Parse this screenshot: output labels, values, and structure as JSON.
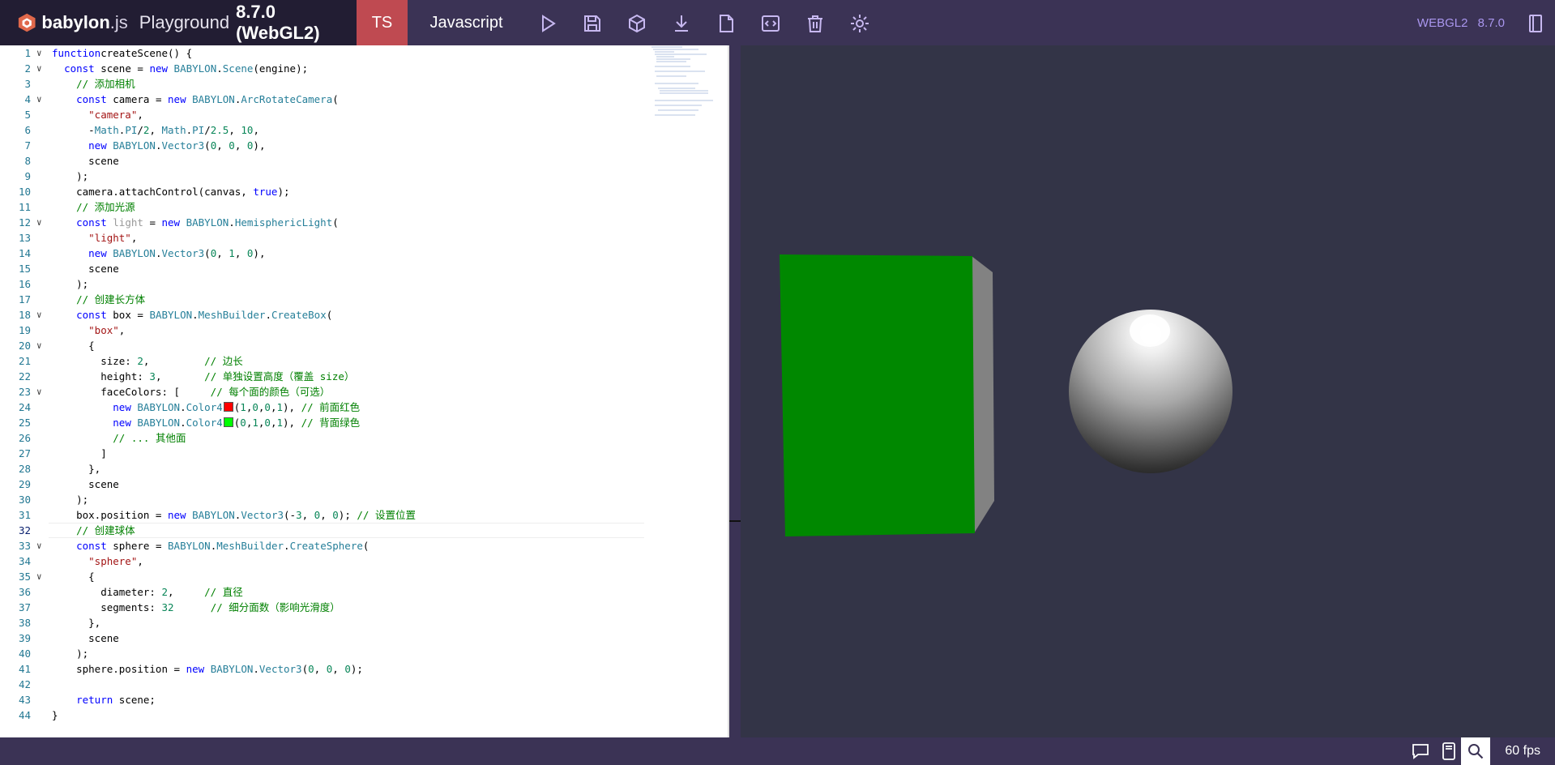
{
  "header": {
    "brand_name": "babylon",
    "brand_suffix": ".js",
    "playground_label": "Playground",
    "version_label": "8.7.0 (WebGL2)",
    "tab_ts": "TS",
    "tab_js": "Javascript",
    "renderer": "WEBGL2",
    "renderer_version": "8.7.0"
  },
  "toolbar": [
    "run-icon",
    "save-icon",
    "download-snippet-icon",
    "download-icon",
    "new-file-icon",
    "format-icon",
    "clear-icon",
    "settings-icon"
  ],
  "editor": {
    "active_line": 32,
    "lines": [
      {
        "n": "1",
        "fold": true,
        "tokens": [
          [
            "kw",
            "function"
          ],
          [
            "",
            "createScene() {"
          ]
        ]
      },
      {
        "n": "2",
        "fold": true,
        "tokens": [
          [
            "",
            "  "
          ],
          [
            "kw",
            "const"
          ],
          [
            "",
            " scene = "
          ],
          [
            "kw",
            "new"
          ],
          [
            "",
            " "
          ],
          [
            "ty",
            "BABYLON"
          ],
          [
            "",
            "."
          ],
          [
            "ty",
            "Scene"
          ],
          [
            "",
            "(engine);"
          ]
        ]
      },
      {
        "n": "3",
        "fold": false,
        "tokens": [
          [
            "",
            "    "
          ],
          [
            "cm",
            "// 添加相机"
          ]
        ]
      },
      {
        "n": "4",
        "fold": true,
        "tokens": [
          [
            "",
            "    "
          ],
          [
            "kw",
            "const"
          ],
          [
            "",
            " camera = "
          ],
          [
            "kw",
            "new"
          ],
          [
            "",
            " "
          ],
          [
            "ty",
            "BABYLON"
          ],
          [
            "",
            "."
          ],
          [
            "ty",
            "ArcRotateCamera"
          ],
          [
            "",
            "("
          ]
        ]
      },
      {
        "n": "5",
        "fold": false,
        "tokens": [
          [
            "",
            "      "
          ],
          [
            "str",
            "\"camera\""
          ],
          [
            "",
            ","
          ]
        ]
      },
      {
        "n": "6",
        "fold": false,
        "tokens": [
          [
            "",
            "      -"
          ],
          [
            "ty",
            "Math"
          ],
          [
            "",
            "."
          ],
          [
            "ty",
            "PI"
          ],
          [
            "",
            "/"
          ],
          [
            "num",
            "2"
          ],
          [
            "",
            ", "
          ],
          [
            "ty",
            "Math"
          ],
          [
            "",
            "."
          ],
          [
            "ty",
            "PI"
          ],
          [
            "",
            "/"
          ],
          [
            "num",
            "2.5"
          ],
          [
            "",
            ", "
          ],
          [
            "num",
            "10"
          ],
          [
            "",
            ","
          ]
        ]
      },
      {
        "n": "7",
        "fold": false,
        "tokens": [
          [
            "",
            "      "
          ],
          [
            "kw",
            "new"
          ],
          [
            "",
            " "
          ],
          [
            "ty",
            "BABYLON"
          ],
          [
            "",
            "."
          ],
          [
            "ty",
            "Vector3"
          ],
          [
            "",
            "("
          ],
          [
            "num",
            "0"
          ],
          [
            "",
            ", "
          ],
          [
            "num",
            "0"
          ],
          [
            "",
            ", "
          ],
          [
            "num",
            "0"
          ],
          [
            "",
            "),"
          ]
        ]
      },
      {
        "n": "8",
        "fold": false,
        "tokens": [
          [
            "",
            "      scene"
          ]
        ]
      },
      {
        "n": "9",
        "fold": false,
        "tokens": [
          [
            "",
            "    );"
          ]
        ]
      },
      {
        "n": "10",
        "fold": false,
        "tokens": [
          [
            "",
            "    camera.attachControl(canvas, "
          ],
          [
            "kw",
            "true"
          ],
          [
            "",
            ");"
          ]
        ]
      },
      {
        "n": "11",
        "fold": false,
        "tokens": [
          [
            "",
            "    "
          ],
          [
            "cm",
            "// 添加光源"
          ]
        ]
      },
      {
        "n": "12",
        "fold": true,
        "tokens": [
          [
            "",
            "    "
          ],
          [
            "kw",
            "const"
          ],
          [
            "",
            " "
          ],
          [
            "lt",
            "light"
          ],
          [
            "",
            " = "
          ],
          [
            "kw",
            "new"
          ],
          [
            "",
            " "
          ],
          [
            "ty",
            "BABYLON"
          ],
          [
            "",
            "."
          ],
          [
            "ty",
            "HemisphericLight"
          ],
          [
            "",
            "("
          ]
        ]
      },
      {
        "n": "13",
        "fold": false,
        "tokens": [
          [
            "",
            "      "
          ],
          [
            "str",
            "\"light\""
          ],
          [
            "",
            ","
          ]
        ]
      },
      {
        "n": "14",
        "fold": false,
        "tokens": [
          [
            "",
            "      "
          ],
          [
            "kw",
            "new"
          ],
          [
            "",
            " "
          ],
          [
            "ty",
            "BABYLON"
          ],
          [
            "",
            "."
          ],
          [
            "ty",
            "Vector3"
          ],
          [
            "",
            "("
          ],
          [
            "num",
            "0"
          ],
          [
            "",
            ", "
          ],
          [
            "num",
            "1"
          ],
          [
            "",
            ", "
          ],
          [
            "num",
            "0"
          ],
          [
            "",
            "),"
          ]
        ]
      },
      {
        "n": "15",
        "fold": false,
        "tokens": [
          [
            "",
            "      scene"
          ]
        ]
      },
      {
        "n": "16",
        "fold": false,
        "tokens": [
          [
            "",
            "    );"
          ]
        ]
      },
      {
        "n": "17",
        "fold": false,
        "tokens": [
          [
            "",
            "    "
          ],
          [
            "cm",
            "// 创建长方体"
          ]
        ]
      },
      {
        "n": "18",
        "fold": true,
        "tokens": [
          [
            "",
            "    "
          ],
          [
            "kw",
            "const"
          ],
          [
            "",
            " box = "
          ],
          [
            "ty",
            "BABYLON"
          ],
          [
            "",
            "."
          ],
          [
            "ty",
            "MeshBuilder"
          ],
          [
            "",
            "."
          ],
          [
            "ty",
            "CreateBox"
          ],
          [
            "",
            "("
          ]
        ]
      },
      {
        "n": "19",
        "fold": false,
        "tokens": [
          [
            "",
            "      "
          ],
          [
            "str",
            "\"box\""
          ],
          [
            "",
            ","
          ]
        ]
      },
      {
        "n": "20",
        "fold": true,
        "tokens": [
          [
            "",
            "      {"
          ]
        ]
      },
      {
        "n": "21",
        "fold": false,
        "tokens": [
          [
            "",
            "        size: "
          ],
          [
            "num",
            "2"
          ],
          [
            "",
            ",         "
          ],
          [
            "cm",
            "// 边长"
          ]
        ]
      },
      {
        "n": "22",
        "fold": false,
        "tokens": [
          [
            "",
            "        height: "
          ],
          [
            "num",
            "3"
          ],
          [
            "",
            ",       "
          ],
          [
            "cm",
            "// 单独设置高度（覆盖 size）"
          ]
        ]
      },
      {
        "n": "23",
        "fold": true,
        "tokens": [
          [
            "",
            "        faceColors: [     "
          ],
          [
            "cm",
            "// 每个面的颜色（可选）"
          ]
        ]
      },
      {
        "n": "24",
        "fold": false,
        "tokens": [
          [
            "",
            "          "
          ],
          [
            "kw",
            "new"
          ],
          [
            "",
            " "
          ],
          [
            "ty",
            "BABYLON"
          ],
          [
            "",
            "."
          ],
          [
            "ty",
            "Color4"
          ],
          [
            "sw-red",
            ""
          ],
          [
            "",
            "("
          ],
          [
            "num",
            "1"
          ],
          [
            "",
            ","
          ],
          [
            "num",
            "0"
          ],
          [
            "",
            ","
          ],
          [
            "num",
            "0"
          ],
          [
            "",
            ","
          ],
          [
            "num",
            "1"
          ],
          [
            "",
            "), "
          ],
          [
            "cm",
            "// 前面红色"
          ]
        ]
      },
      {
        "n": "25",
        "fold": false,
        "tokens": [
          [
            "",
            "          "
          ],
          [
            "kw",
            "new"
          ],
          [
            "",
            " "
          ],
          [
            "ty",
            "BABYLON"
          ],
          [
            "",
            "."
          ],
          [
            "ty",
            "Color4"
          ],
          [
            "sw-green",
            ""
          ],
          [
            "",
            "("
          ],
          [
            "num",
            "0"
          ],
          [
            "",
            ","
          ],
          [
            "num",
            "1"
          ],
          [
            "",
            ","
          ],
          [
            "num",
            "0"
          ],
          [
            "",
            ","
          ],
          [
            "num",
            "1"
          ],
          [
            "",
            "), "
          ],
          [
            "cm",
            "// 背面绿色"
          ]
        ]
      },
      {
        "n": "26",
        "fold": false,
        "tokens": [
          [
            "",
            "          "
          ],
          [
            "cm",
            "// ... 其他面"
          ]
        ]
      },
      {
        "n": "27",
        "fold": false,
        "tokens": [
          [
            "",
            "        ]"
          ]
        ]
      },
      {
        "n": "28",
        "fold": false,
        "tokens": [
          [
            "",
            "      },"
          ]
        ]
      },
      {
        "n": "29",
        "fold": false,
        "tokens": [
          [
            "",
            "      scene"
          ]
        ]
      },
      {
        "n": "30",
        "fold": false,
        "tokens": [
          [
            "",
            "    );"
          ]
        ]
      },
      {
        "n": "31",
        "fold": false,
        "tokens": [
          [
            "",
            "    box.position = "
          ],
          [
            "kw",
            "new"
          ],
          [
            "",
            " "
          ],
          [
            "ty",
            "BABYLON"
          ],
          [
            "",
            "."
          ],
          [
            "ty",
            "Vector3"
          ],
          [
            "",
            "(-"
          ],
          [
            "num",
            "3"
          ],
          [
            "",
            ", "
          ],
          [
            "num",
            "0"
          ],
          [
            "",
            ", "
          ],
          [
            "num",
            "0"
          ],
          [
            "",
            "); "
          ],
          [
            "cm",
            "// 设置位置"
          ]
        ]
      },
      {
        "n": "32",
        "fold": false,
        "tokens": [
          [
            "",
            "    "
          ],
          [
            "cm",
            "// 创建球体"
          ]
        ]
      },
      {
        "n": "33",
        "fold": true,
        "tokens": [
          [
            "",
            "    "
          ],
          [
            "kw",
            "const"
          ],
          [
            "",
            " sphere = "
          ],
          [
            "ty",
            "BABYLON"
          ],
          [
            "",
            "."
          ],
          [
            "ty",
            "MeshBuilder"
          ],
          [
            "",
            "."
          ],
          [
            "ty",
            "CreateSphere"
          ],
          [
            "",
            "("
          ]
        ]
      },
      {
        "n": "34",
        "fold": false,
        "tokens": [
          [
            "",
            "      "
          ],
          [
            "str",
            "\"sphere\""
          ],
          [
            "",
            ","
          ]
        ]
      },
      {
        "n": "35",
        "fold": true,
        "tokens": [
          [
            "",
            "      {"
          ]
        ]
      },
      {
        "n": "36",
        "fold": false,
        "tokens": [
          [
            "",
            "        diameter: "
          ],
          [
            "num",
            "2"
          ],
          [
            "",
            ",     "
          ],
          [
            "cm",
            "// 直径"
          ]
        ]
      },
      {
        "n": "37",
        "fold": false,
        "tokens": [
          [
            "",
            "        segments: "
          ],
          [
            "num",
            "32"
          ],
          [
            "",
            "      "
          ],
          [
            "cm",
            "// 细分面数（影响光滑度）"
          ]
        ]
      },
      {
        "n": "38",
        "fold": false,
        "tokens": [
          [
            "",
            "      },"
          ]
        ]
      },
      {
        "n": "39",
        "fold": false,
        "tokens": [
          [
            "",
            "      scene"
          ]
        ]
      },
      {
        "n": "40",
        "fold": false,
        "tokens": [
          [
            "",
            "    );"
          ]
        ]
      },
      {
        "n": "41",
        "fold": false,
        "tokens": [
          [
            "",
            "    sphere.position = "
          ],
          [
            "kw",
            "new"
          ],
          [
            "",
            " "
          ],
          [
            "ty",
            "BABYLON"
          ],
          [
            "",
            "."
          ],
          [
            "ty",
            "Vector3"
          ],
          [
            "",
            "("
          ],
          [
            "num",
            "0"
          ],
          [
            "",
            ", "
          ],
          [
            "num",
            "0"
          ],
          [
            "",
            ", "
          ],
          [
            "num",
            "0"
          ],
          [
            "",
            ");"
          ]
        ]
      },
      {
        "n": "42",
        "fold": false,
        "tokens": []
      },
      {
        "n": "43",
        "fold": false,
        "tokens": [
          [
            "",
            "    "
          ],
          [
            "kw",
            "return"
          ],
          [
            "",
            " scene;"
          ]
        ]
      },
      {
        "n": "44",
        "fold": false,
        "tokens": [
          [
            "",
            "}"
          ]
        ]
      }
    ]
  },
  "scene": {
    "background": "#333447",
    "box_front_color": "#008800",
    "box_side_color": "#808080",
    "sphere_color": "#9a9a9a"
  },
  "footer": {
    "icons": [
      "chat-icon",
      "inspector-icon",
      "search-icon"
    ],
    "fps": "60 fps"
  },
  "colors": {
    "header_bg": "#3b3355",
    "brand_bg": "#221d33",
    "ts_tab_bg": "#bf4a51",
    "accent": "#a996ee"
  }
}
